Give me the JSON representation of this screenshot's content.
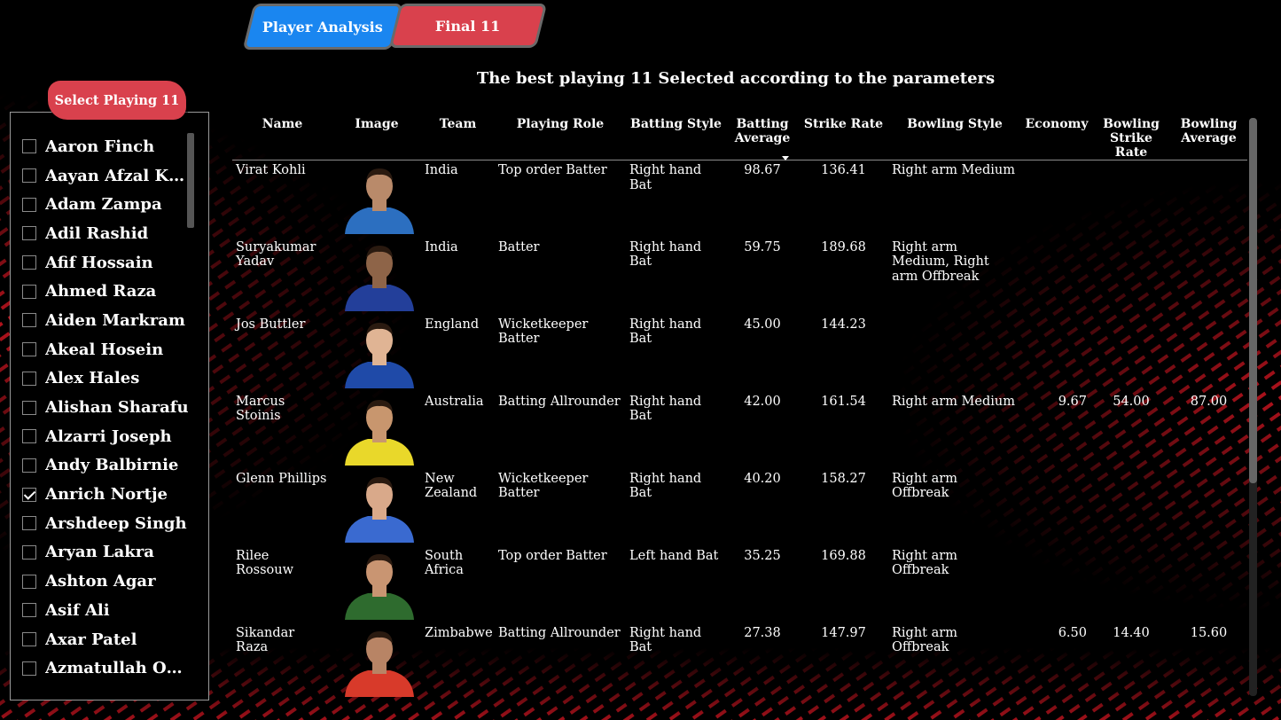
{
  "tabs": [
    {
      "label": "Player Analysis",
      "color": "#1a86f0"
    },
    {
      "label": "Final 11",
      "color": "#d9414d"
    }
  ],
  "slicer": {
    "title": "Select Playing 11",
    "items": [
      {
        "label": "Aaron Finch",
        "checked": false
      },
      {
        "label": "Aayan Afzal Khan",
        "checked": false
      },
      {
        "label": "Adam Zampa",
        "checked": false
      },
      {
        "label": "Adil Rashid",
        "checked": false
      },
      {
        "label": "Afif Hossain",
        "checked": false
      },
      {
        "label": "Ahmed Raza",
        "checked": false
      },
      {
        "label": "Aiden Markram",
        "checked": false
      },
      {
        "label": "Akeal Hosein",
        "checked": false
      },
      {
        "label": "Alex Hales",
        "checked": false
      },
      {
        "label": "Alishan Sharafu",
        "checked": false
      },
      {
        "label": "Alzarri Joseph",
        "checked": false
      },
      {
        "label": "Andy Balbirnie",
        "checked": false
      },
      {
        "label": "Anrich Nortje",
        "checked": true
      },
      {
        "label": "Arshdeep Singh",
        "checked": false
      },
      {
        "label": "Aryan Lakra",
        "checked": false
      },
      {
        "label": "Ashton Agar",
        "checked": false
      },
      {
        "label": "Asif Ali",
        "checked": false
      },
      {
        "label": "Axar Patel",
        "checked": false
      },
      {
        "label": "Azmatullah Omarzai",
        "checked": false
      }
    ]
  },
  "main": {
    "title": "The best playing 11 Selected according to the parameters",
    "columns": [
      "Name",
      "Image",
      "Team",
      "Playing Role",
      "Batting Style",
      "Batting Average",
      "Strike Rate",
      "Bowling Style",
      "Economy",
      "Bowling Strike Rate",
      "Bowling Average"
    ],
    "sorted_column": "Batting Average",
    "rows": [
      {
        "name": "Virat Kohli",
        "team": "India",
        "role": "Top order Batter",
        "bat_style": "Right hand Bat",
        "bat_avg": "98.67",
        "strike_rate": "136.41",
        "bowl_style": "Right arm Medium",
        "economy": "",
        "bowl_sr": "",
        "bowl_avg": "",
        "jersey": "#2c6fc0",
        "skin": "#b98a6a"
      },
      {
        "name": "Suryakumar Yadav",
        "team": "India",
        "role": "Batter",
        "bat_style": "Right hand Bat",
        "bat_avg": "59.75",
        "strike_rate": "189.68",
        "bowl_style": "Right arm Medium, Right arm Offbreak",
        "economy": "",
        "bowl_sr": "",
        "bowl_avg": "",
        "jersey": "#233f9a",
        "skin": "#8e6448"
      },
      {
        "name": "Jos Buttler",
        "team": "England",
        "role": "Wicketkeeper Batter",
        "bat_style": "Right hand Bat",
        "bat_avg": "45.00",
        "strike_rate": "144.23",
        "bowl_style": "",
        "economy": "",
        "bowl_sr": "",
        "bowl_avg": "",
        "jersey": "#1f4aa8",
        "skin": "#e0b494"
      },
      {
        "name": "Marcus Stoinis",
        "team": "Australia",
        "role": "Batting Allrounder",
        "bat_style": "Right hand Bat",
        "bat_avg": "42.00",
        "strike_rate": "161.54",
        "bowl_style": "Right arm Medium",
        "economy": "9.67",
        "bowl_sr": "54.00",
        "bowl_avg": "87.00",
        "jersey": "#e9d82a",
        "skin": "#c8966e"
      },
      {
        "name": "Glenn Phillips",
        "team": "New Zealand",
        "role": "Wicketkeeper Batter",
        "bat_style": "Right hand Bat",
        "bat_avg": "40.20",
        "strike_rate": "158.27",
        "bowl_style": "Right arm Offbreak",
        "economy": "",
        "bowl_sr": "",
        "bowl_avg": "",
        "jersey": "#3a6ad0",
        "skin": "#d9a98a"
      },
      {
        "name": "Rilee Rossouw",
        "team": "South Africa",
        "role": "Top order Batter",
        "bat_style": "Left hand Bat",
        "bat_avg": "35.25",
        "strike_rate": "169.88",
        "bowl_style": "Right arm Offbreak",
        "economy": "",
        "bowl_sr": "",
        "bowl_avg": "",
        "jersey": "#2e6b2e",
        "skin": "#c99572"
      },
      {
        "name": "Sikandar Raza",
        "team": "Zimbabwe",
        "role": "Batting Allrounder",
        "bat_style": "Right hand Bat",
        "bat_avg": "27.38",
        "strike_rate": "147.97",
        "bowl_style": "Right arm Offbreak",
        "economy": "6.50",
        "bowl_sr": "14.40",
        "bowl_avg": "15.60",
        "jersey": "#d83a2a",
        "skin": "#b88465"
      }
    ]
  }
}
